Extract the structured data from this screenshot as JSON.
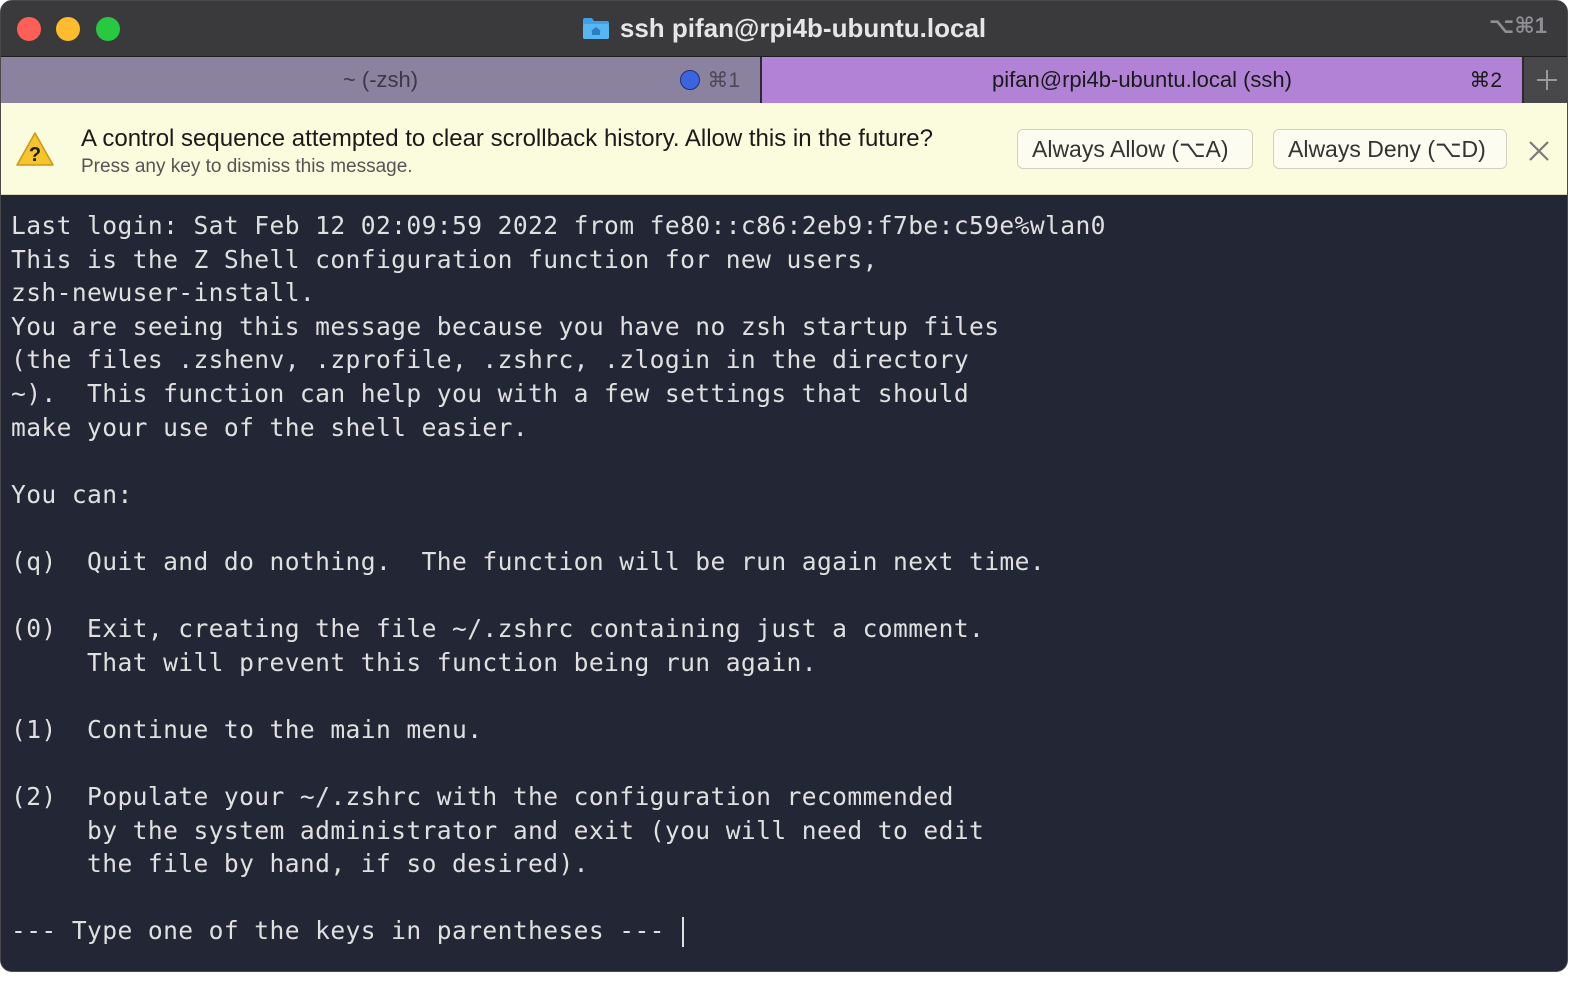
{
  "window": {
    "title": "ssh pifan@rpi4b-ubuntu.local",
    "shortcut": "⌥⌘1",
    "title_icon": "home-folder-icon"
  },
  "tabs": [
    {
      "label": "~ (-zsh)",
      "shortcut": "⌘1",
      "active": false
    },
    {
      "label": "pifan@rpi4b-ubuntu.local (ssh)",
      "shortcut": "⌘2",
      "active": true
    }
  ],
  "banner": {
    "message": "A control sequence attempted to clear scrollback history. Allow this in the future?",
    "sub": "Press any key to dismiss this message.",
    "allow_label": "Always Allow (⌥A)",
    "deny_label": "Always Deny (⌥D)"
  },
  "terminal": {
    "lines": [
      "Last login: Sat Feb 12 02:09:59 2022 from fe80::c86:2eb9:f7be:c59e%wlan0",
      "This is the Z Shell configuration function for new users,",
      "zsh-newuser-install.",
      "You are seeing this message because you have no zsh startup files",
      "(the files .zshenv, .zprofile, .zshrc, .zlogin in the directory",
      "~).  This function can help you with a few settings that should",
      "make your use of the shell easier.",
      "",
      "You can:",
      "",
      "(q)  Quit and do nothing.  The function will be run again next time.",
      "",
      "(0)  Exit, creating the file ~/.zshrc containing just a comment.",
      "     That will prevent this function being run again.",
      "",
      "(1)  Continue to the main menu.",
      "",
      "(2)  Populate your ~/.zshrc with the configuration recommended",
      "     by the system administrator and exit (you will need to edit",
      "     the file by hand, if so desired).",
      "",
      "--- Type one of the keys in parentheses --- "
    ]
  },
  "colors": {
    "terminal_bg": "#232634",
    "active_tab": "#b282d6",
    "inactive_tab": "#8b82a0",
    "banner_bg": "#fbfbdd"
  }
}
